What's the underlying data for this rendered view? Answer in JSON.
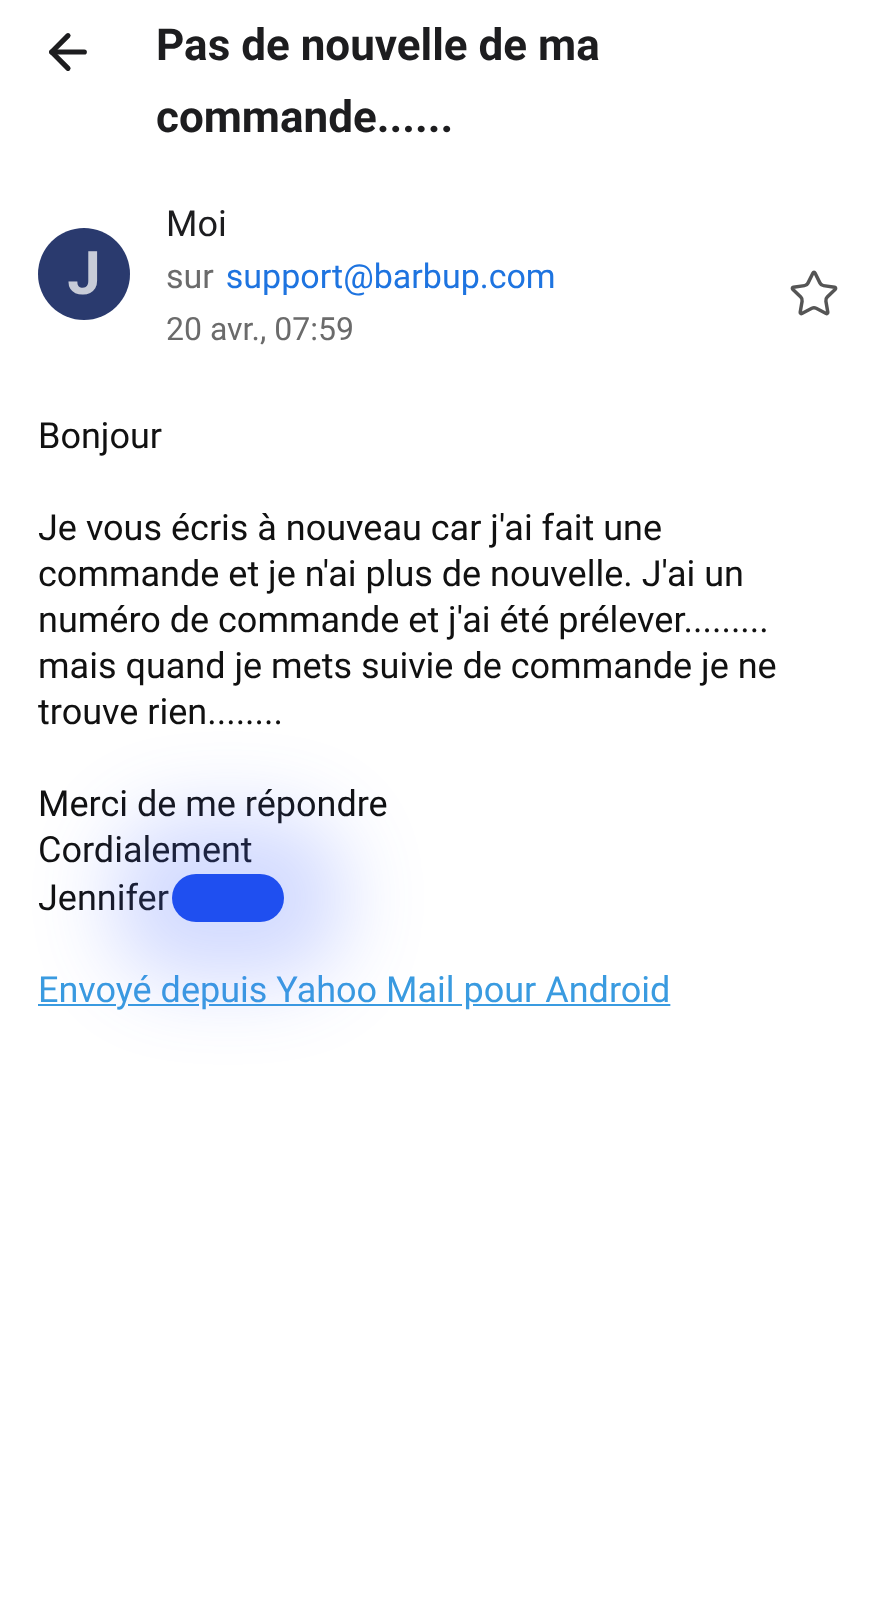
{
  "header": {
    "title": "Pas de nouvelle de ma commande......"
  },
  "message": {
    "avatar_letter": "J",
    "sender": "Moi",
    "to_prefix": "sur",
    "to_address": "support@barbup.com",
    "date": "20 avr., 07:59",
    "starred": false
  },
  "body": {
    "greeting": "Bonjour",
    "paragraph": "Je vous écris à nouveau car j'ai fait une commande et je n'ai plus de nouvelle. J'ai un numéro de commande et j'ai été prélever......... mais quand je mets suivie de commande je ne trouve rien........",
    "closing_lines": [
      "Merci de me répondre",
      "Cordialement",
      "Jennifer"
    ],
    "signature_link": "Envoyé depuis Yahoo Mail pour Android"
  }
}
